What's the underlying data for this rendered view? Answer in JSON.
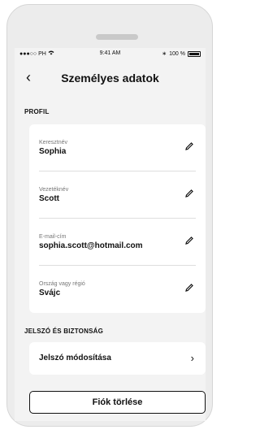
{
  "status_bar": {
    "signal": "●●●○○",
    "carrier": "PH",
    "time": "9:41 AM",
    "battery": "100 %"
  },
  "header": {
    "back_icon": "‹",
    "title": "Személyes adatok"
  },
  "profile": {
    "section_title": "PROFIL",
    "fields": [
      {
        "label": "Keresztnév",
        "value": "Sophia"
      },
      {
        "label": "Vezetéknév",
        "value": "Scott"
      },
      {
        "label": "E-mail-cím",
        "value": "sophia.scott@hotmail.com"
      },
      {
        "label": "Ország vagy régió",
        "value": "Svájc"
      }
    ]
  },
  "security": {
    "section_title": "JELSZÓ ÉS BIZTONSÁG",
    "change_password": "Jelszó módosítása",
    "chevron": "›"
  },
  "actions": {
    "delete_account": "Fiók törlése"
  },
  "colors": {
    "background": "#f3f3f3",
    "card": "#ffffff",
    "text": "#111111",
    "label": "#777777"
  }
}
